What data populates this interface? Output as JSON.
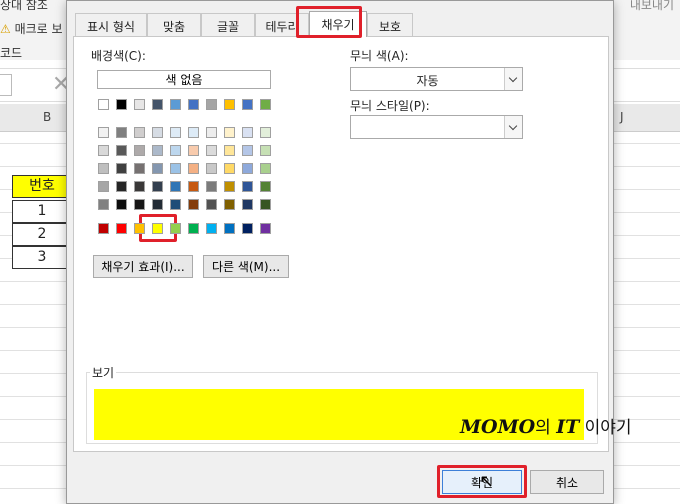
{
  "background": {
    "ribbon_line1": "상대 참조",
    "ribbon_line2": "매크로 보",
    "ribbon_line3": "코드",
    "ribbon_right": "내보내기",
    "col_b": "B",
    "col_j": "J",
    "table": {
      "header": "번호",
      "rows": [
        "1",
        "2",
        "3"
      ]
    }
  },
  "dialog": {
    "tabs": [
      "표시 형식",
      "맞춤",
      "글꼴",
      "테두리",
      "채우기",
      "보호"
    ],
    "active_tab": "채우기",
    "background_color_label": "배경색(C):",
    "no_color_button": "색 없음",
    "fill_effects_button": "채우기 효과(I)...",
    "more_colors_button": "다른 색(M)...",
    "pattern_color_label": "무늬 색(A):",
    "pattern_color_value": "자동",
    "pattern_style_label": "무늬 스타일(P):",
    "pattern_style_value": "",
    "sample_label": "보기",
    "sample_color": "#FFFF00",
    "selected_color": "#FFFF00",
    "ok_button": "확인",
    "cancel_button": "취소"
  },
  "palette": {
    "theme_top": [
      "#FFFFFF",
      "#000000",
      "#E7E6E6",
      "#44546A",
      "#5B9BD5",
      "#4472C4",
      "#A5A5A5",
      "#FFC000",
      "#4472C4",
      "#70AD47"
    ],
    "theme_shades": [
      [
        "#F2F2F2",
        "#808080",
        "#D0CECE",
        "#D6DCE4",
        "#DEEBF6",
        "#DDEBF7",
        "#EDEDED",
        "#FFF2CC",
        "#D9E1F2",
        "#E2EFDA"
      ],
      [
        "#D9D9D9",
        "#595959",
        "#AEAAAA",
        "#ACB9CA",
        "#BDD7EE",
        "#F8CBAD",
        "#DBDBDB",
        "#FFE699",
        "#B4C6E7",
        "#C6E0B4"
      ],
      [
        "#BFBFBF",
        "#404040",
        "#767171",
        "#8497B0",
        "#9BC2E6",
        "#F4B084",
        "#C9C9C9",
        "#FFD966",
        "#8EA9DB",
        "#A9D08E"
      ],
      [
        "#A6A6A6",
        "#262626",
        "#3A3838",
        "#333F4F",
        "#2F75B5",
        "#C65911",
        "#7B7B7B",
        "#BF8F00",
        "#2F5597",
        "#548235"
      ],
      [
        "#808080",
        "#0D0D0D",
        "#171616",
        "#222B35",
        "#1F4E78",
        "#833C0B",
        "#525252",
        "#806000",
        "#1F3864",
        "#375623"
      ]
    ],
    "standard": [
      "#C00000",
      "#FF0000",
      "#FFC000",
      "#FFFF00",
      "#92D050",
      "#00B050",
      "#00B0F0",
      "#0070C0",
      "#002060",
      "#7030A0"
    ]
  },
  "watermark": {
    "brand": "MOMO",
    "mid": "의 ",
    "it": "IT",
    "tail": " 이야기"
  }
}
